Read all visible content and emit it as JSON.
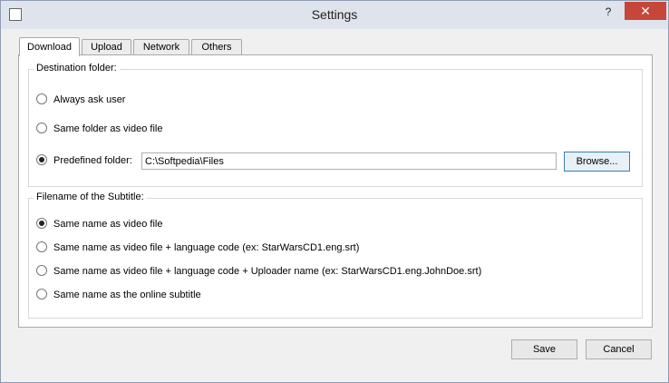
{
  "window": {
    "title": "Settings",
    "help": "?",
    "close": "✕"
  },
  "tabs": [
    {
      "label": "Download",
      "active": true
    },
    {
      "label": "Upload",
      "active": false
    },
    {
      "label": "Network",
      "active": false
    },
    {
      "label": "Others",
      "active": false
    }
  ],
  "destination": {
    "title": "Destination folder:",
    "options": [
      {
        "label": "Always ask user",
        "checked": false
      },
      {
        "label": "Same folder as video file",
        "checked": false
      },
      {
        "label": "Predefined folder:",
        "checked": true
      }
    ],
    "folder_value": "C:\\Softpedia\\Files",
    "browse_label": "Browse..."
  },
  "filename": {
    "title": "Filename of the Subtitle:",
    "options": [
      {
        "label": "Same name as video file",
        "checked": true
      },
      {
        "label": "Same name as video file + language code (ex: StarWarsCD1.eng.srt)",
        "checked": false
      },
      {
        "label": "Same name as video file + language code + Uploader name (ex: StarWarsCD1.eng.JohnDoe.srt)",
        "checked": false
      },
      {
        "label": "Same name as the online subtitle",
        "checked": false
      }
    ]
  },
  "footer": {
    "save_label": "Save",
    "cancel_label": "Cancel"
  }
}
